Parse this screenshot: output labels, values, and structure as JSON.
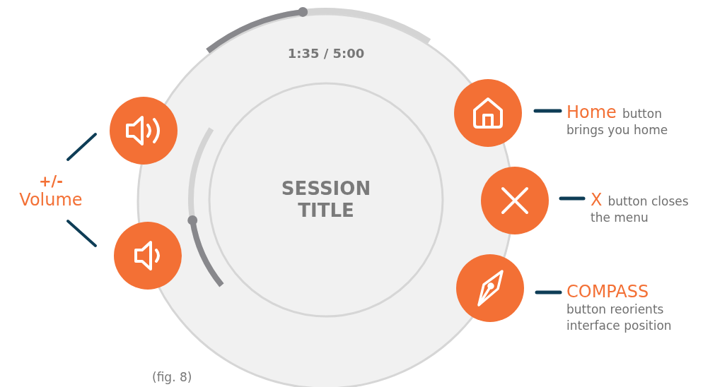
{
  "player": {
    "elapsed_time": "1:35 / 5:00",
    "time_progress": {
      "level": 0.44
    },
    "title": "SESSION TITLE",
    "volume": {
      "level": 0.43
    }
  },
  "volume_buttons": [
    {
      "kind": "volume-up"
    },
    {
      "kind": "volume-down"
    }
  ],
  "volume_label": [
    "+/-",
    "Volume"
  ],
  "callouts": [
    {
      "kind": "home",
      "heading": "Home",
      "after_heading": "button",
      "lines": [
        "brings you home"
      ]
    },
    {
      "kind": "close",
      "heading": "X",
      "after_heading": "button closes",
      "lines": [
        "the menu"
      ]
    },
    {
      "kind": "compass",
      "heading": "COMPASS",
      "lines": [
        "button reorients",
        "interface position"
      ]
    }
  ],
  "caption": "(fig. 8)"
}
